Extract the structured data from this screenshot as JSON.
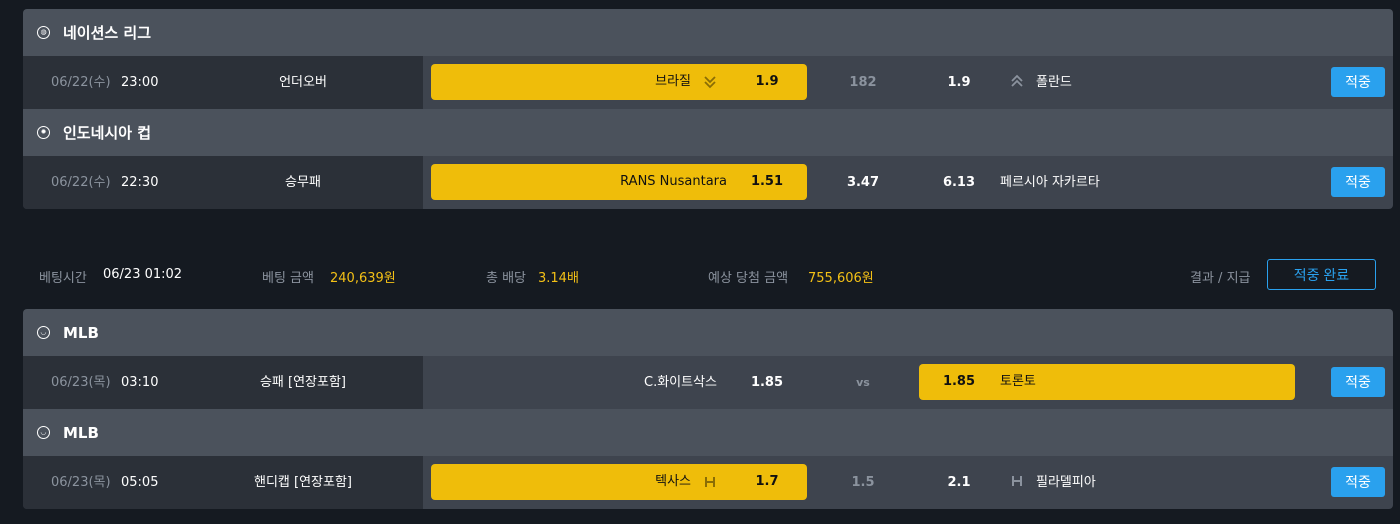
{
  "bets_top": [
    {
      "league": "네이션스 리그",
      "league_icon": "volleyball-icon",
      "date": "06/22(수)",
      "time": "23:00",
      "market": "언더오버",
      "home": "브라질",
      "home_odd": "1.9",
      "line": "182",
      "away_odd": "1.9",
      "away": "폴란드",
      "result_label": "적중"
    },
    {
      "league": "인도네시아 컵",
      "league_icon": "soccer-ball-icon",
      "date": "06/22(수)",
      "time": "22:30",
      "market": "승무패",
      "home": "RANS Nusantara",
      "home_odd": "1.51",
      "line": "3.47",
      "away_odd": "6.13",
      "away": "페르시아 자카르타",
      "result_label": "적중"
    }
  ],
  "summary": {
    "bet_time_label": "베팅시간",
    "bet_time": "06/23 01:02",
    "amount_label": "베팅 금액",
    "amount": "240,639원",
    "total_odds_label": "총 배당",
    "total_odds": "3.14배",
    "expected_label": "예상 당첨 금액",
    "expected": "755,606원",
    "result_pay_label": "결과 / 지급",
    "status_button": "적중 완료"
  },
  "bets_bottom": [
    {
      "league": "MLB",
      "league_icon": "baseball-icon",
      "date": "06/23(목)",
      "time": "03:10",
      "market": "승패 [연장포함]",
      "home": "C.화이트삭스",
      "home_odd": "1.85",
      "line": "vs",
      "away_odd": "1.85",
      "away": "토론토",
      "result_label": "적중"
    },
    {
      "league": "MLB",
      "league_icon": "baseball-icon",
      "date": "06/23(목)",
      "time": "05:05",
      "market": "핸디캡 [연장포함]",
      "home": "텍사스",
      "home_odd": "1.7",
      "line": "1.5",
      "away_odd": "2.1",
      "away": "필라델피아",
      "result_label": "적중"
    }
  ],
  "colors": {
    "selected": "#efbd0a",
    "accent": "#2aa1ee",
    "highlight_text": "#f3c016"
  }
}
